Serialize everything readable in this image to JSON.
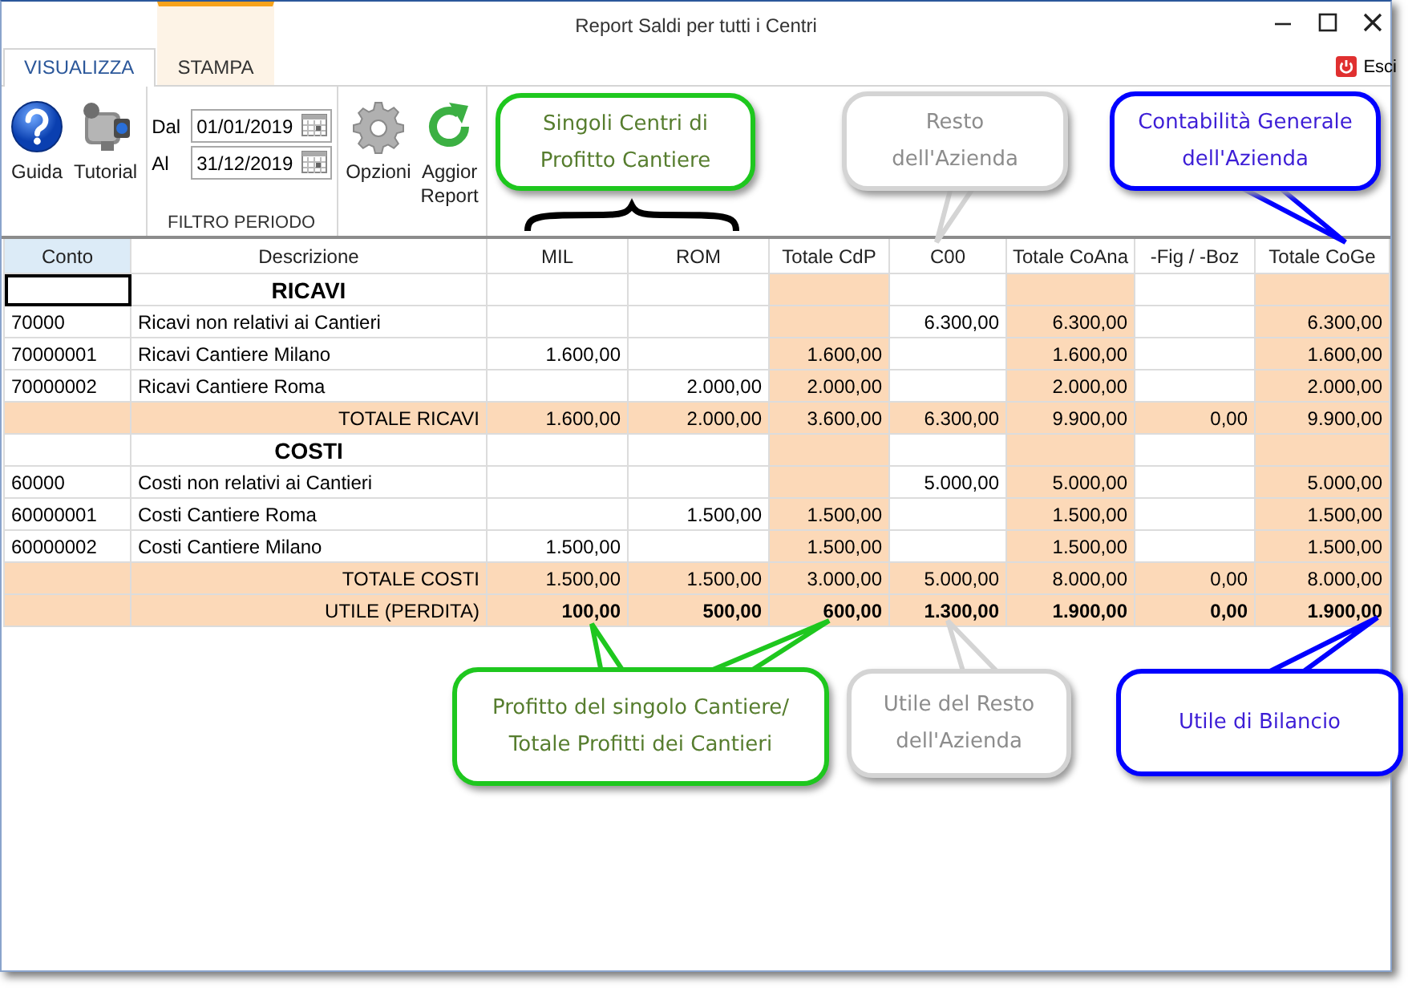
{
  "window": {
    "title": "Report Saldi per tutti i Centri"
  },
  "tabs": [
    {
      "label": "VISUALIZZA",
      "selected": true,
      "kind": "normal"
    },
    {
      "label": "STAMPA",
      "selected": false,
      "kind": "contextual"
    }
  ],
  "exit": {
    "label": "Esci"
  },
  "ribbon": {
    "groups": [
      {
        "buttons": [
          {
            "kind": "help",
            "label": "Guida"
          },
          {
            "kind": "video",
            "label": "Tutorial"
          }
        ]
      },
      {
        "label": "FILTRO PERIODO",
        "dates": [
          {
            "label": "Dal",
            "value": "01/01/2019"
          },
          {
            "label": "Al",
            "value": "31/12/2019"
          }
        ]
      },
      {
        "buttons": [
          {
            "kind": "settings",
            "label": "Opzioni"
          },
          {
            "kind": "refresh",
            "label": "Aggior\nReport"
          }
        ]
      }
    ]
  },
  "table": {
    "columns": [
      {
        "label": "Conto",
        "shaded": false
      },
      {
        "label": "Descrizione",
        "shaded": false
      },
      {
        "label": "MIL",
        "shaded": false
      },
      {
        "label": "ROM",
        "shaded": false
      },
      {
        "label": "Totale CdP",
        "shaded": true
      },
      {
        "label": "C00",
        "shaded": false
      },
      {
        "label": "Totale CoAna",
        "shaded": true
      },
      {
        "label": "-Fig / -Boz",
        "shaded": false
      },
      {
        "label": "Totale CoGe",
        "shaded": true
      }
    ],
    "rows": [
      {
        "kind": "section",
        "cursor": true,
        "descrizione": "RICAVI",
        "values": {}
      },
      {
        "kind": "account",
        "cursor": false,
        "conto": "70000",
        "descrizione": "Ricavi non relativi ai Cantieri",
        "values": {
          "c00": "6.300,00",
          "totale_coana": "6.300,00",
          "totale_coge": "6.300,00"
        }
      },
      {
        "kind": "account",
        "cursor": false,
        "conto": "70000001",
        "descrizione": "Ricavi Cantiere Milano",
        "values": {
          "mil": "1.600,00",
          "totale_cdp": "1.600,00",
          "totale_coana": "1.600,00",
          "totale_coge": "1.600,00"
        }
      },
      {
        "kind": "account",
        "cursor": false,
        "conto": "70000002",
        "descrizione": "Ricavi Cantiere Roma",
        "values": {
          "rom": "2.000,00",
          "totale_cdp": "2.000,00",
          "totale_coana": "2.000,00",
          "totale_coge": "2.000,00"
        }
      },
      {
        "kind": "total",
        "cursor": false,
        "descrizione": "TOTALE RICAVI",
        "values": {
          "mil": "1.600,00",
          "rom": "2.000,00",
          "totale_cdp": "3.600,00",
          "c00": "6.300,00",
          "totale_coana": "9.900,00",
          "fig_boz": "0,00",
          "totale_coge": "9.900,00"
        }
      },
      {
        "kind": "section",
        "cursor": false,
        "descrizione": "COSTI",
        "values": {}
      },
      {
        "kind": "account",
        "cursor": false,
        "conto": "60000",
        "descrizione": "Costi non relativi ai Cantieri",
        "values": {
          "c00": "5.000,00",
          "totale_coana": "5.000,00",
          "totale_coge": "5.000,00"
        }
      },
      {
        "kind": "account",
        "cursor": false,
        "conto": "60000001",
        "descrizione": "Costi Cantiere Roma",
        "values": {
          "rom": "1.500,00",
          "totale_cdp": "1.500,00",
          "totale_coana": "1.500,00",
          "totale_coge": "1.500,00"
        }
      },
      {
        "kind": "account",
        "cursor": false,
        "conto": "60000002",
        "descrizione": "Costi Cantiere Milano",
        "values": {
          "mil": "1.500,00",
          "totale_cdp": "1.500,00",
          "totale_coana": "1.500,00",
          "totale_coge": "1.500,00"
        }
      },
      {
        "kind": "total",
        "cursor": false,
        "descrizione": "TOTALE COSTI",
        "values": {
          "mil": "1.500,00",
          "rom": "1.500,00",
          "totale_cdp": "3.000,00",
          "c00": "5.000,00",
          "totale_coana": "8.000,00",
          "fig_boz": "0,00",
          "totale_coge": "8.000,00"
        }
      },
      {
        "kind": "result",
        "cursor": false,
        "descrizione": "UTILE (PERDITA)",
        "values": {
          "mil": "100,00",
          "rom": "500,00",
          "totale_cdp": "600,00",
          "c00": "1.300,00",
          "totale_coana": "1.900,00",
          "fig_boz": "0,00",
          "totale_coge": "1.900,00"
        }
      }
    ]
  },
  "callouts": [
    {
      "kind": "centri",
      "color": "#1ec71e",
      "text": "Singoli Centri di Profitto Cantiere"
    },
    {
      "kind": "resto",
      "color": "#d4d4d4",
      "text": "Resto dell'Azienda"
    },
    {
      "kind": "generale",
      "color": "#0000ff",
      "text": "Contabilità Generale dell'Azienda"
    },
    {
      "kind": "centri",
      "color": "#1ec71e",
      "text": "Profitto del singolo Cantiere/ Totale Profitti dei Cantieri"
    },
    {
      "kind": "resto",
      "color": "#d4d4d4",
      "text": "Utile del Resto dell'Azienda"
    },
    {
      "kind": "generale",
      "color": "#0000ff",
      "text": "Utile di Bilancio"
    }
  ]
}
